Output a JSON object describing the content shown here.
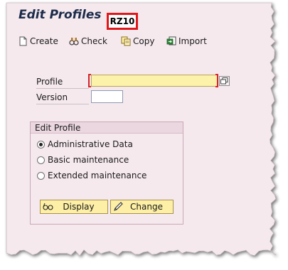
{
  "title": "Edit Profiles",
  "transaction_code": "RZ10",
  "toolbar": {
    "items": [
      {
        "label": "Create",
        "icon": "create-document-icon"
      },
      {
        "label": "Check",
        "icon": "check-icon"
      },
      {
        "label": "Copy",
        "icon": "copy-icon"
      },
      {
        "label": "Import",
        "icon": "import-icon"
      }
    ]
  },
  "form": {
    "profile_label": "Profile",
    "profile_value": "",
    "version_label": "Version",
    "version_value": ""
  },
  "edit_profile": {
    "title": "Edit Profile",
    "options": [
      {
        "label": "Administrative Data",
        "selected": true
      },
      {
        "label": "Basic maintenance",
        "selected": false
      },
      {
        "label": "Extended maintenance",
        "selected": false
      }
    ],
    "buttons": {
      "display_label": "Display",
      "change_label": "Change"
    }
  },
  "colors": {
    "background": "#f5e9ee",
    "accent_red": "#e0181b",
    "required_field": "#fcf2a9",
    "button_fill": "#fdefa6"
  }
}
